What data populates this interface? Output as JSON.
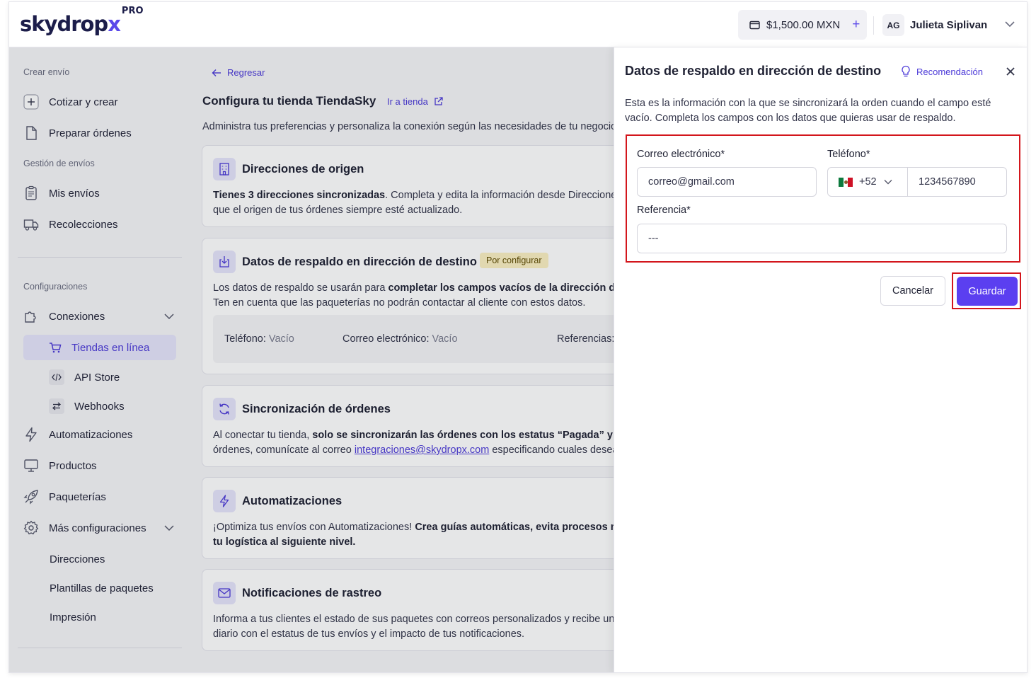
{
  "brand": {
    "name_part1": "skydrop",
    "name_x": "x",
    "tier": "PRO",
    "accent": "#5b49e9"
  },
  "header": {
    "balance": "$1,500.00 MXN",
    "user_initials": "AG",
    "user_name": "Julieta Siplivan"
  },
  "sidebar": {
    "section_create": "Crear envío",
    "cotizar": "Cotizar y crear",
    "preparar": "Preparar órdenes",
    "section_gestion": "Gestión de envíos",
    "mis_envios": "Mis envíos",
    "recolecciones": "Recolecciones",
    "section_config": "Configuraciones",
    "conexiones": "Conexiones",
    "tiendas": "Tiendas en línea",
    "api_store": "API Store",
    "webhooks": "Webhooks",
    "automatizaciones": "Automatizaciones",
    "productos": "Productos",
    "paqueterias": "Paqueterías",
    "mas_config": "Más configuraciones",
    "direcciones": "Direcciones",
    "plantillas": "Plantillas de paquetes",
    "impresion": "Impresión"
  },
  "main": {
    "back": "Regresar",
    "title": "Configura tu tienda TiendaSky",
    "store_link": "Ir a tienda",
    "description": "Administra tus preferencias y personaliza la conexión según las necesidades de tu negocio.",
    "cards": {
      "origen": {
        "title": "Direcciones de origen",
        "line1_bold": "Tienes 3 direcciones sincronizadas",
        "line1_rest": ". Completa y edita la información desde Direcciones para asegurar",
        "line2": "que el origen de tus órdenes siempre esté actualizado."
      },
      "respaldo": {
        "title": "Datos de respaldo en dirección de destino",
        "badge": "Por configurar",
        "line1_start": "Los datos de respaldo se usarán para ",
        "line1_bold": "completar los campos vacíos de la dirección de destino.",
        "line2": "Ten en cuenta que las paqueterías no podrán contactar al cliente con estos datos.",
        "tel_label": "Teléfono:",
        "tel_value": "Vacío",
        "email_label": "Correo electrónico:",
        "email_value": "Vacío",
        "ref_label": "Referencias:"
      },
      "sync": {
        "title": "Sincronización de órdenes",
        "line1_start": "Al conectar tu tienda, ",
        "line1_bold": "solo se sincronizarán las órdenes con los estatus “Pagada” y “Pendiente”.",
        "line2_start": "órdenes, comunícate al correo ",
        "line2_link": "integraciones@skydropx.com",
        "line2_rest": " especificando cuales deseas sincronizar."
      },
      "auto": {
        "title": "Automatizaciones",
        "line1_start": "¡Optimiza tus envíos con Automatizaciones! ",
        "line1_bold": "Crea guías automáticas, evita procesos manuales y lleva",
        "line2_bold": "tu logística al siguiente nivel."
      },
      "notif": {
        "title": "Notificaciones de rastreo",
        "line1": "Informa a tus clientes el estado de sus paquetes con correos personalizados y recibe un reporte",
        "line2": "diario con el estatus de tus envíos y el impacto de tus notificaciones."
      }
    }
  },
  "drawer": {
    "title": "Datos de respaldo en dirección de destino",
    "recommendation": "Recomendación",
    "description": "Esta es la información con la que se sincronizará la orden cuando el campo esté vacío. Completa los campos con los datos que quieras usar de respaldo.",
    "email_label": "Correo electrónico*",
    "email_value": "correo@gmail.com",
    "phone_label": "Teléfono*",
    "country_code": "+52",
    "phone_value": "1234567890",
    "reference_label": "Referencia*",
    "reference_value": "---",
    "cancel": "Cancelar",
    "save": "Guardar"
  }
}
